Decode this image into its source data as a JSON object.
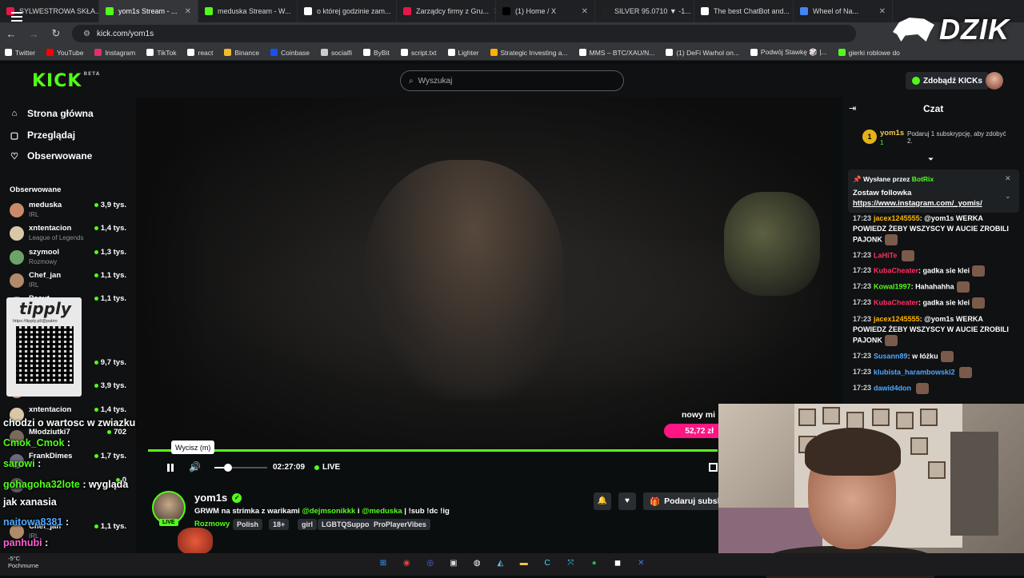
{
  "browser": {
    "tabs": [
      {
        "label": "SYLWESTROWA SKŁA...",
        "color": "#e5174a",
        "active": false
      },
      {
        "label": "yom1s Stream - ...",
        "color": "#53fc18",
        "active": true
      },
      {
        "label": "meduska Stream - W...",
        "color": "#53fc18",
        "active": false
      },
      {
        "label": "o której godzinie zam...",
        "color": "#ffffff",
        "active": false
      },
      {
        "label": "Zarządcy firmy z Gru...",
        "color": "#e5174a",
        "active": false
      },
      {
        "label": "(1) Home / X",
        "color": "#000000",
        "active": false
      },
      {
        "label": "SILVER 95.0710 ▼ -1...",
        "color": "#222222",
        "active": false
      },
      {
        "label": "The best ChatBot and...",
        "color": "#ffffff",
        "active": false
      },
      {
        "label": "Wheel of Na...",
        "color": "#4285f4",
        "active": false
      }
    ],
    "url": "kick.com/yom1s",
    "bookmarks": [
      {
        "label": "Twitter",
        "color": "#ffffff"
      },
      {
        "label": "YouTube",
        "color": "#ff0000"
      },
      {
        "label": "Instagram",
        "color": "#e1306c"
      },
      {
        "label": "TikTok",
        "color": "#ffffff"
      },
      {
        "label": "react",
        "color": "#ffffff"
      },
      {
        "label": "Binance",
        "color": "#f3ba2f"
      },
      {
        "label": "Coinbase",
        "color": "#1652f0"
      },
      {
        "label": "socialfi",
        "color": "#cccccc"
      },
      {
        "label": "ByBit",
        "color": "#ffffff"
      },
      {
        "label": "script.txt",
        "color": "#ffffff"
      },
      {
        "label": "Lighter",
        "color": "#ffffff"
      },
      {
        "label": "Strategic Investing a...",
        "color": "#ffb300"
      },
      {
        "label": "MMS – BTC/XAU/N...",
        "color": "#ffffff"
      },
      {
        "label": "(1) DeFi Warhol on...",
        "color": "#ffffff"
      },
      {
        "label": "Podwój Stawkę 🎲 |...",
        "color": "#ffffff"
      },
      {
        "label": "gierki roblowe do",
        "color": "#53fc18"
      }
    ],
    "overlay_brand": "DZIK"
  },
  "kick": {
    "logo": "KICK",
    "logo_sup": "BETA",
    "search_placeholder": "Wyszukaj",
    "get_kicks": "Zdobądź KICKs"
  },
  "sidebar": {
    "nav": [
      {
        "label": "Strona główna",
        "icon": "⌂"
      },
      {
        "label": "Przeglądaj",
        "icon": "▢"
      },
      {
        "label": "Obserwowane",
        "icon": "♡"
      }
    ],
    "following_title": "Obserwowane",
    "following": [
      {
        "name": "meduska",
        "category": "IRL",
        "viewers": "3,9 tys.",
        "color": "#c98b6b"
      },
      {
        "name": "xntentacion",
        "category": "League of Legends",
        "viewers": "1,4 tys.",
        "color": "#d9c7a8"
      },
      {
        "name": "szymool",
        "category": "Rozmowy",
        "viewers": "1,3 tys.",
        "color": "#6ba36b"
      },
      {
        "name": "Chef_jan",
        "category": "IRL",
        "viewers": "1,1 tys.",
        "color": "#b08a6a"
      },
      {
        "name": "Pasut",
        "category": "",
        "viewers": "1,1 tys.",
        "color": "#8a8a8a"
      },
      {
        "name": "",
        "category": "",
        "viewers": "9,7 tys.",
        "color": "#9a7a5a"
      },
      {
        "name": "",
        "category": "",
        "viewers": "3,9 tys.",
        "color": "#c98b6b"
      },
      {
        "name": "xntentacion",
        "category": "",
        "viewers": "1,4 tys.",
        "color": "#d9c7a8"
      },
      {
        "name": "Młodziutki7",
        "category": "",
        "viewers": "702",
        "color": "#7a6a5a"
      },
      {
        "name": "FrankDimes",
        "category": "",
        "viewers": "1,7 tys.",
        "color": "#6a6a7a"
      },
      {
        "name": "",
        "category": "",
        "viewers": "0",
        "color": "#5a5a5a"
      },
      {
        "name": "Chef_jan",
        "category": "IRL",
        "viewers": "1,1 tys.",
        "color": "#b08a6a"
      }
    ]
  },
  "tipply": {
    "logo": "tipply",
    "url": "https://tipply.pl/@patiro"
  },
  "player": {
    "tooltip": "Wycisz (m)",
    "time": "02:27:09",
    "live": "LIVE",
    "volume": 0.2,
    "donation_name": "nowy mi",
    "donation_amount": "52,72 zł"
  },
  "stream": {
    "channel": "yom1s",
    "live_tag": "LIVE",
    "title_pre": "GRWM na strimka z warikami ",
    "mention1": "@dejmsonikkk",
    "title_mid": " i ",
    "mention2": "@meduska",
    "title_post": " | !sub !dc !ig",
    "category": "Rozmowy",
    "tags": [
      "Polish",
      "18+",
      "girl",
      "LGBTQSupport",
      "ProPlayerVibes"
    ],
    "gift_label": "Podaruj subsk"
  },
  "chat": {
    "title": "Czat",
    "leader_rank": "1",
    "leader_name": "yom1s",
    "leader_count": "1",
    "leader_gift": "Podaruj 1 subskrypcję, aby zdobyć 2.",
    "pinned_by_label": "Wysłane przez",
    "pinned_by": "BotRix",
    "pinned_text": "Zostaw followka",
    "pinned_link": "https://www.instagram.com/_yomis/",
    "messages": [
      {
        "time": "17:23",
        "user": "jacex1245555",
        "color": "#ffb600",
        "text": "@yom1s WERKA POWIEDZ ŻEBY WSZYSCY W AUCIE ZROBILI PAJONK"
      },
      {
        "time": "17:23",
        "user": "LaHiTe",
        "color": "#ff2e63",
        "text": ""
      },
      {
        "time": "17:23",
        "user": "KubaCheater",
        "color": "#ff2e63",
        "text": "gadka sie klei"
      },
      {
        "time": "17:23",
        "user": "Kowal1997",
        "color": "#53fc18",
        "text": "Hahahahha"
      },
      {
        "time": "17:23",
        "user": "KubaCheater",
        "color": "#ff2e63",
        "text": "gadka sie klei"
      },
      {
        "time": "17:23",
        "user": "jacex1245555",
        "color": "#ffb600",
        "text": "@yom1s WERKA POWIEDZ ŻEBY WSZYSCY W AUCIE ZROBILI PAJONK"
      },
      {
        "time": "17:23",
        "user": "Susann89",
        "color": "#4fa8ff",
        "text": "w łóżku"
      },
      {
        "time": "17:23",
        "user": "klubista_harambowski2",
        "color": "#4fa8ff",
        "text": ""
      },
      {
        "time": "17:23",
        "user": "dawid4don",
        "color": "#4fa8ff",
        "text": ""
      }
    ]
  },
  "overlay_chat": [
    {
      "user": "",
      "text": "chodzi o wartosc w zwiazku",
      "cls": "n"
    },
    {
      "user": "Cmok_Cmok",
      "text": " :",
      "cls": "n"
    },
    {
      "user": "sarowi",
      "text": " :",
      "cls": "n"
    },
    {
      "user": "gohagoha32lote",
      "text": " : wygląda",
      "cls": "n"
    },
    {
      "user": "",
      "text": "jak xanasia",
      "cls": "n"
    },
    {
      "user": "naitowa8381",
      "text": " :",
      "cls": "n2"
    },
    {
      "user": "panhubi",
      "text": " :",
      "cls": "n3"
    }
  ],
  "overlay_counter": "x392",
  "taskbar": {
    "weather_temp": "-5°C",
    "weather_desc": "Pochmurne",
    "icons": [
      {
        "name": "windows",
        "color": "#3aa0ff",
        "glyph": "⊞"
      },
      {
        "name": "chrome",
        "color": "#ea4335",
        "glyph": "◉"
      },
      {
        "name": "discord",
        "color": "#5865f2",
        "glyph": "◎"
      },
      {
        "name": "app",
        "color": "#dddddd",
        "glyph": "▣"
      },
      {
        "name": "obs",
        "color": "#ffffff",
        "glyph": "◍"
      },
      {
        "name": "steam",
        "color": "#66c0f4",
        "glyph": "◭"
      },
      {
        "name": "folder",
        "color": "#f5c242",
        "glyph": "▬"
      },
      {
        "name": "cursor",
        "color": "#4ad6ff",
        "glyph": "C"
      },
      {
        "name": "vpn",
        "color": "#4ad6ff",
        "glyph": "⤧"
      },
      {
        "name": "spotify",
        "color": "#1db954",
        "glyph": "●"
      },
      {
        "name": "capture",
        "color": "#ffffff",
        "glyph": "◼"
      },
      {
        "name": "tool",
        "color": "#3a7bff",
        "glyph": "✕"
      }
    ]
  }
}
